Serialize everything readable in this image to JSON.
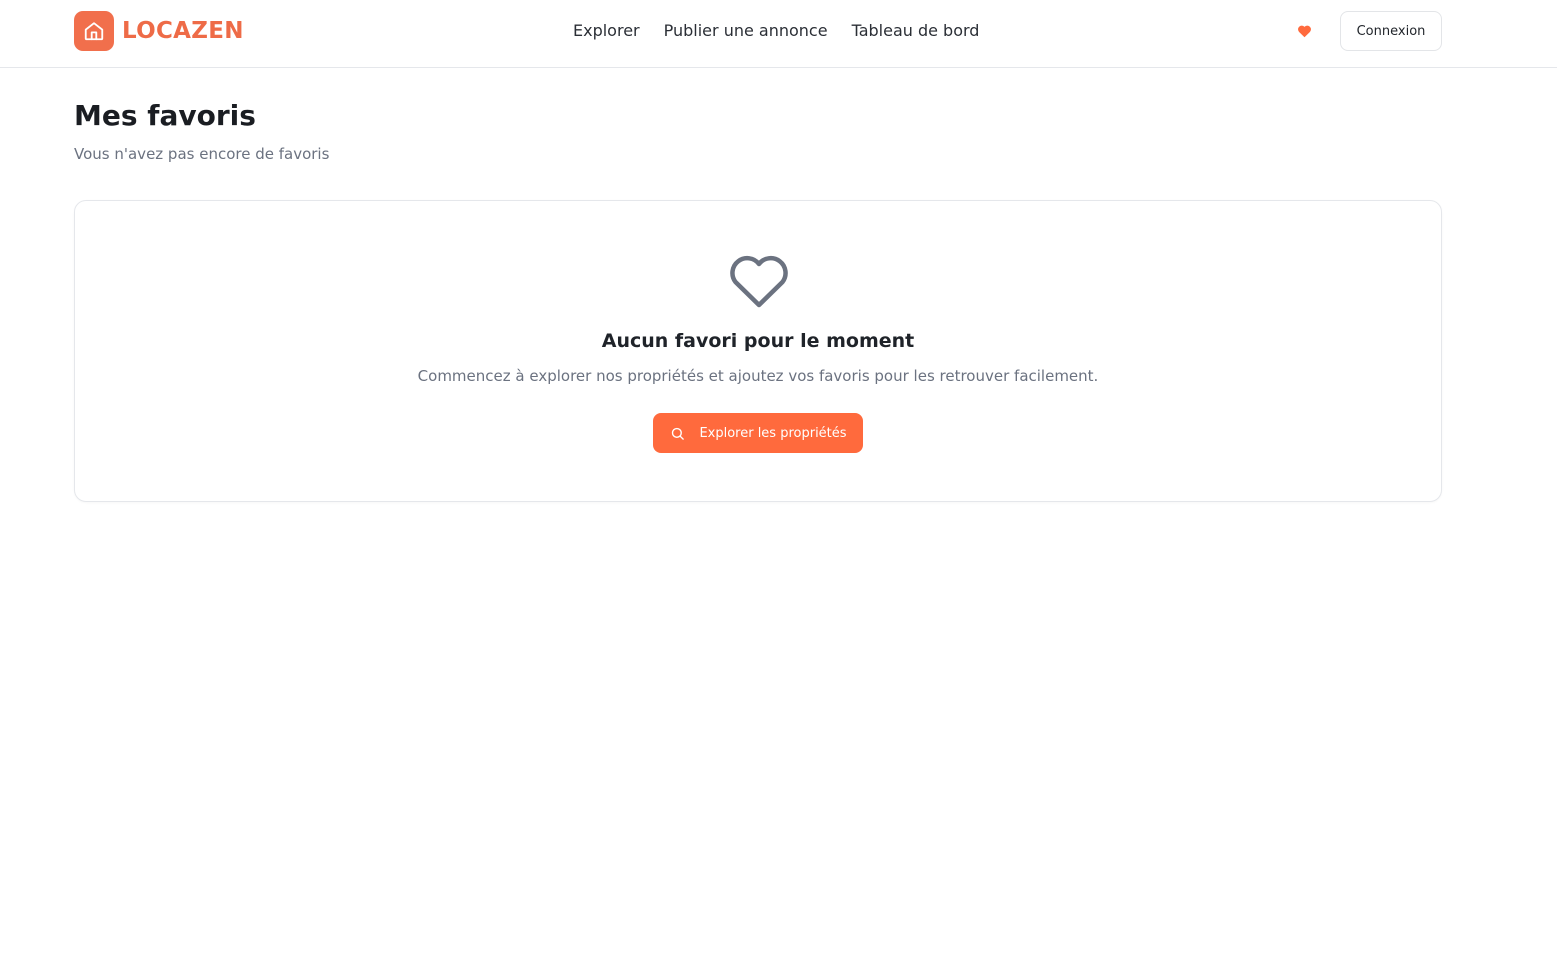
{
  "header": {
    "brand": {
      "name": "LOCAZEN",
      "logo_icon": "house-icon"
    },
    "nav": [
      {
        "label": "Explorer"
      },
      {
        "label": "Publier une annonce"
      },
      {
        "label": "Tableau de bord"
      }
    ],
    "favorites_icon": "heart-icon",
    "login_label": "Connexion"
  },
  "page": {
    "title": "Mes favoris",
    "subtitle": "Vous n'avez pas encore de favoris"
  },
  "empty_state": {
    "icon": "heart-outline-icon",
    "title": "Aucun favori pour le moment",
    "text": "Commencez à explorer nos propriétés et ajoutez vos favoris pour les retrouver facilement.",
    "button_label": "Explorer les propriétés",
    "button_icon": "search-icon"
  },
  "colors": {
    "accent": "#ff6a3d",
    "brand": "#ee6b47",
    "text_muted": "#6b7280",
    "border": "#e5e7eb"
  }
}
